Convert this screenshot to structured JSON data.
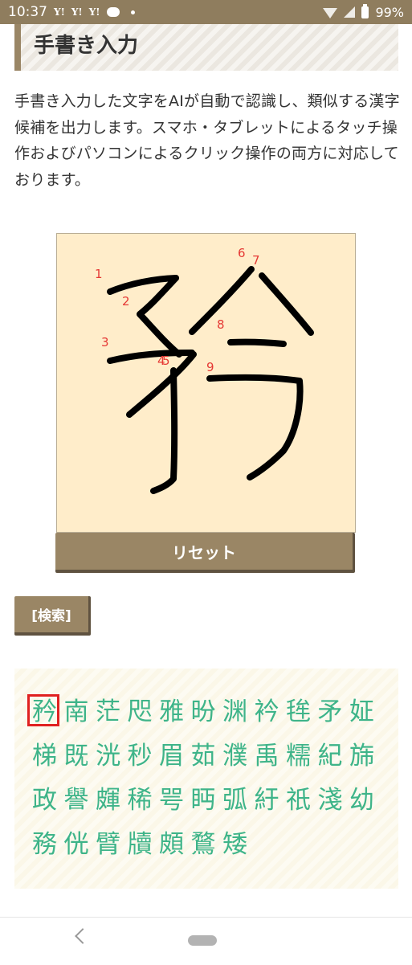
{
  "status": {
    "time": "10:37",
    "yahoo_label": "Y!",
    "battery": "99%"
  },
  "page": {
    "title": "手書き入力",
    "description": "手書き入力した文字をAIが自動で認識し、類似する漢字候補を出力します。スマホ・タブレットによるタッチ操作およびパソコンによるクリック操作の両方に対応しております。"
  },
  "canvas": {
    "stroke_numbers": [
      "1",
      "2",
      "3",
      "4",
      "5",
      "6",
      "7",
      "8",
      "9"
    ],
    "background": "#ffedca"
  },
  "buttons": {
    "reset": "リセット",
    "search": "[検索]"
  },
  "results": {
    "selected_index": 0,
    "rows": [
      [
        "矜",
        "南",
        "茫",
        "咫",
        "雅",
        "昐",
        "渊",
        "衿",
        "毪",
        "矛",
        "姃"
      ],
      [
        "梯",
        "既",
        "洸",
        "秒",
        "眉",
        "茹",
        "濮",
        "禹",
        "糯",
        "紀",
        "旆"
      ],
      [
        "政",
        "譽",
        "皹",
        "稀",
        "咢",
        "眄",
        "弧",
        "紆",
        "祇",
        "淺",
        "幼"
      ],
      [
        "務",
        "侊",
        "臂",
        "牘",
        "頗",
        "鶩",
        "矮"
      ]
    ]
  },
  "colors": {
    "accent": "#9a8665",
    "result_text": "#3eb489",
    "selected_border": "#e02020"
  }
}
